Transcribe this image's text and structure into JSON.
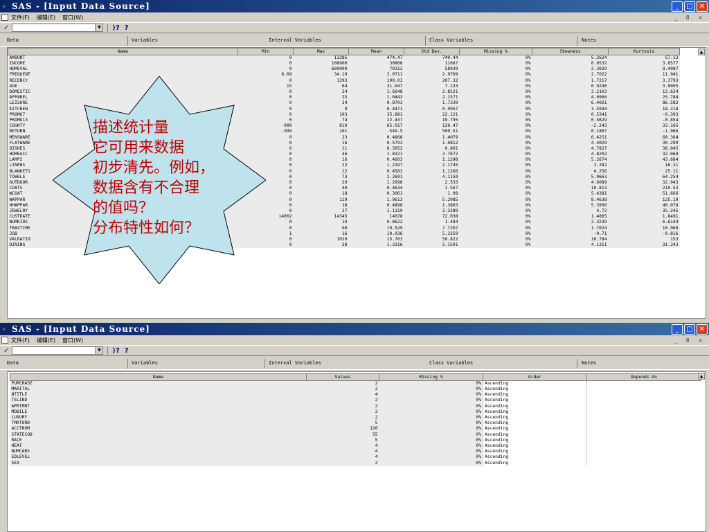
{
  "window1": {
    "title": "SAS - [Input Data Source]",
    "menu": [
      "文件(F)",
      "编辑(E)",
      "窗口(W)"
    ],
    "window_controls": "_ 8 ×",
    "tabs": [
      "Data",
      "Variables",
      "Interval Variables",
      "Class Variables",
      "Notes"
    ],
    "columns": [
      "Name",
      "Min",
      "Max",
      "Mean",
      "Std Dev.",
      "Missing %",
      "Skewness",
      "Kurtosis"
    ],
    "rows": [
      [
        "AMOUNT",
        "0",
        "13285",
        "474.47",
        "749.44",
        "0%",
        "5.2624",
        "57.13"
      ],
      [
        "INCOME",
        "0",
        "108900",
        "30806",
        "11667",
        "0%",
        "0.0532",
        "3.0577"
      ],
      [
        "HOMEVAL",
        "0",
        "600000",
        "79312",
        "58939",
        "0%",
        "2.3029",
        "8.4987"
      ],
      [
        "FREQUENT",
        "0.09",
        "34.19",
        "3.0711",
        "2.9709",
        "0%",
        "2.7022",
        "11.941"
      ],
      [
        "RECENCY",
        "0",
        "1393",
        "190.03",
        "207.32",
        "0%",
        "1.7217",
        "3.3793"
      ],
      [
        "AGE",
        "15",
        "64",
        "31.047",
        "7.133",
        "0%",
        "0.9240",
        "3.0005"
      ],
      [
        "DOMESTIC",
        "0",
        "24",
        "1.6648",
        "2.8521",
        "0%",
        "3.2103",
        "13.634"
      ],
      [
        "APPAREL",
        "0",
        "25",
        "1.0443",
        "2.1571",
        "0%",
        "4.0966",
        "25.784"
      ],
      [
        "LEISURE",
        "0",
        "34",
        "0.8703",
        "1.7339",
        "0%",
        "6.4021",
        "86.582"
      ],
      [
        "KITCHEN",
        "0",
        "9",
        "0.4471",
        "0.9957",
        "0%",
        "3.5944",
        "18.318"
      ],
      [
        "PROMO7",
        "0",
        "103",
        "35.881",
        "22.121",
        "0%",
        "0.5341",
        "-0.393"
      ],
      [
        "PROMO13",
        "0",
        "74",
        "22.437",
        "19.795",
        "0%",
        "0.5629",
        "-0.854"
      ],
      [
        "COUNTY",
        "-999",
        "810",
        "65.017",
        "129.47",
        "0%",
        "-2.243",
        "33.165"
      ],
      [
        "RETURN",
        "-999",
        "101",
        "-549.5",
        "500.51",
        "0%",
        "0.1807",
        "-1.966"
      ],
      [
        "MENSWARE",
        "0",
        "23",
        "0.4868",
        "1.4079",
        "0%",
        "6.4251",
        "60.364"
      ],
      [
        "FLATWARE",
        "0",
        "16",
        "0.5793",
        "1.0812",
        "0%",
        "4.4029",
        "30.299"
      ],
      [
        "DISHES",
        "0",
        "11",
        "0.3052",
        "0.801",
        "0%",
        "4.7827",
        "38.045"
      ],
      [
        "HOMEACC",
        "0",
        "46",
        "1.8321",
        "3.7672",
        "0%",
        "4.8202",
        "32.068"
      ],
      [
        "LAMPS",
        "0",
        "16",
        "0.4603",
        "1.1298",
        "0%",
        "5.2674",
        "43.684"
      ],
      [
        "LINENS",
        "0",
        "22",
        "1.2197",
        "2.1745",
        "0%",
        "3.282",
        "16.21"
      ],
      [
        "BLANKETS",
        "0",
        "12",
        "0.4583",
        "1.1266",
        "0%",
        "4.256",
        "25.11"
      ],
      [
        "TOWELS",
        "0",
        "73",
        "2.2691",
        "4.1159",
        "0%",
        "5.9663",
        "64.254"
      ],
      [
        "OUTDOOR",
        "0",
        "29",
        "1.2696",
        "2.533",
        "0%",
        "4.6089",
        "32.943"
      ],
      [
        "COATS",
        "0",
        "40",
        "0.4634",
        "1.567",
        "0%",
        "10.813",
        "210.53"
      ],
      [
        "WCOAT",
        "0",
        "18",
        "0.3061",
        "1.08",
        "0%",
        "5.4381",
        "51.666"
      ],
      [
        "WAPPAR",
        "0",
        "119",
        "1.9613",
        "5.2985",
        "0%",
        "8.4638",
        "135.19"
      ],
      [
        "HHAPPAR",
        "0",
        "18",
        "0.4898",
        "1.3803",
        "0%",
        "5.3956",
        "40.078"
      ],
      [
        "JEWELRY",
        "0",
        "27",
        "1.1119",
        "2.3289",
        "0%",
        "4.72",
        "35.245"
      ],
      [
        "CUSTDATE",
        "14002",
        "14345",
        "14078",
        "72.038",
        "0%",
        "1.4865",
        "1.8491"
      ],
      [
        "NUMKIDS",
        "0",
        "10",
        "0.8622",
        "1.484",
        "0%",
        "2.3239",
        "6.6144"
      ],
      [
        "TRAVTIME",
        "0",
        "90",
        "19.529",
        "7.7207",
        "0%",
        "1.7024",
        "10.968"
      ],
      [
        "JOB",
        "1",
        "16",
        "10.036",
        "5.3259",
        "0%",
        "-0.71",
        "-0.816"
      ],
      [
        "VALRATIO",
        "0",
        "1029",
        "15.763",
        "50.822",
        "0%",
        "10.784",
        "153"
      ],
      [
        "DINING",
        "0",
        "28",
        "1.3316",
        "2.1501",
        "0%",
        "4.1311",
        "31.343"
      ]
    ]
  },
  "window2": {
    "title": "SAS - [Input Data Source]",
    "menu": [
      "文件(F)",
      "编辑(E)",
      "窗口(W)"
    ],
    "window_controls": "_ 8 ×",
    "tabs": [
      "Data",
      "Variables",
      "Interval Variables",
      "Class Variables",
      "Notes"
    ],
    "columns": [
      "Name",
      "Values",
      "Missing %",
      "Order",
      "Depends On"
    ],
    "rows": [
      [
        "PURCHASE",
        "2",
        "0%",
        "Ascending",
        ""
      ],
      [
        "MARITAL",
        "2",
        "0%",
        "Ascending",
        ""
      ],
      [
        "NTITLE",
        "4",
        "0%",
        "Ascending",
        ""
      ],
      [
        "TELIND",
        "2",
        "0%",
        "Ascending",
        ""
      ],
      [
        "APRTMNT",
        "2",
        "0%",
        "Ascending",
        ""
      ],
      [
        "MOBILE",
        "2",
        "0%",
        "Ascending",
        ""
      ],
      [
        "LUXURY",
        "2",
        "0%",
        "Ascending",
        ""
      ],
      [
        "TMKTORD",
        "5",
        "0%",
        "Ascending",
        ""
      ],
      [
        "ACCTNUM",
        "120",
        "0%",
        "Ascending",
        ""
      ],
      [
        "STATECOD",
        "55",
        "0%",
        "Ascending",
        ""
      ],
      [
        "RACE",
        "5",
        "0%",
        "Ascending",
        ""
      ],
      [
        "HEAT",
        "4",
        "0%",
        "Ascending",
        ""
      ],
      [
        "NUMCARS",
        "4",
        "0%",
        "Ascending",
        ""
      ],
      [
        "EDLEVEL",
        "4",
        "0%",
        "Ascending",
        ""
      ],
      [
        "SEX",
        "2",
        "0%",
        "Ascending",
        ""
      ]
    ]
  },
  "callout": "描述统计量\n它可用来数据\n初步清先。例如，\n数据含有不合理\n的值吗？\n分布特性如何？",
  "colors": {
    "title_bar": "#0a246a",
    "callout_fill": "#bfe3ec",
    "callout_text": "#c00000",
    "row_bg": "#ebebeb"
  }
}
